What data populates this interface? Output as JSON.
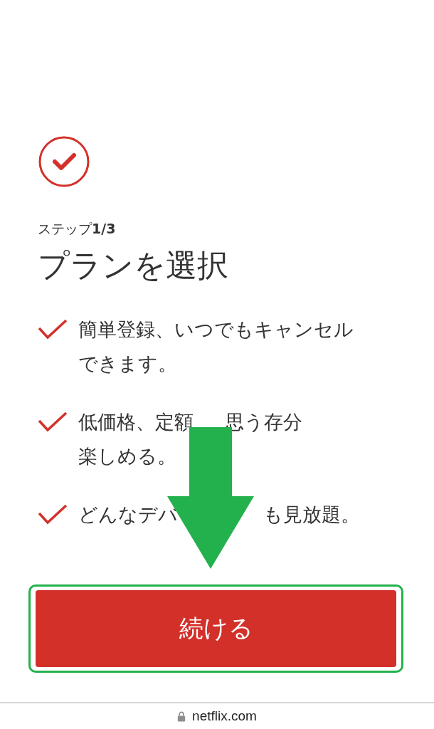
{
  "step": "ステップ**1/3**",
  "title": "プランを選択",
  "features": [
    {
      "lines": [
        [
          "簡単登録、いつでもキャンセル"
        ],
        [
          "できます。"
        ]
      ]
    },
    {
      "lines": [
        [
          "低価格、定額",
          "思う存分"
        ],
        [
          "楽しめる。"
        ]
      ]
    },
    {
      "lines": [
        [
          "どんなデバ",
          "も見放題。"
        ]
      ]
    }
  ],
  "continue_button": "続ける",
  "address_bar": {
    "url": "netflix.com"
  }
}
